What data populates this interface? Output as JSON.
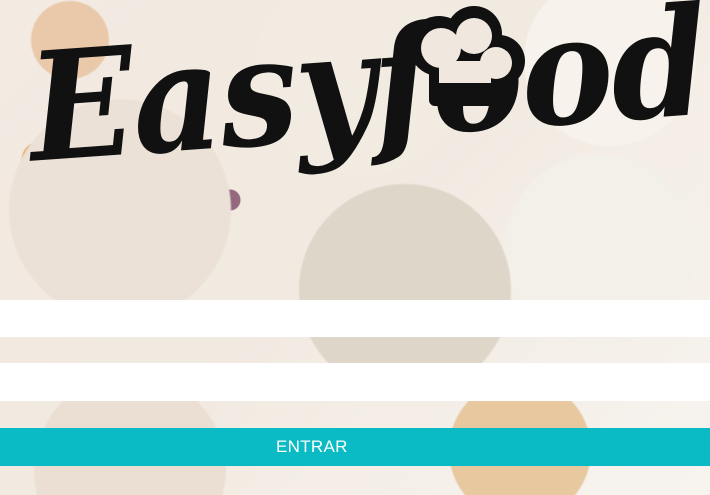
{
  "brand": {
    "logo_text": "Easyfood",
    "logo_icon": "chef-hat-icon",
    "logo_color": "#111111"
  },
  "login_form": {
    "username_field": {
      "value": "",
      "placeholder": ""
    },
    "password_field": {
      "value": "",
      "placeholder": ""
    },
    "submit_label": "ENTRAR",
    "submit_color": "#0abac4"
  },
  "background": {
    "image_subject": "food-photo-background"
  }
}
